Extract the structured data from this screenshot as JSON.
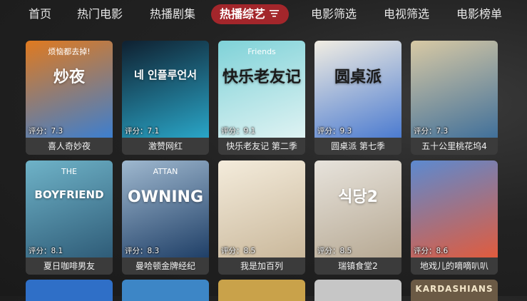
{
  "nav": {
    "tabs": [
      {
        "label": "首页"
      },
      {
        "label": "热门电影"
      },
      {
        "label": "热播剧集"
      },
      {
        "label": "热播综艺",
        "active": true,
        "icon": "filter-icon"
      },
      {
        "label": "电影筛选"
      },
      {
        "label": "电视筛选"
      },
      {
        "label": "电影榜单"
      }
    ]
  },
  "cards": [
    {
      "title": "喜人奇妙夜",
      "rating_label": "评分：",
      "rating": "7.3",
      "poster_text": "炒夜",
      "poster_sub": "烦恼都去掉!",
      "color": "#e07a1f",
      "color2": "#3b7fd1"
    },
    {
      "title": "激赞网红",
      "rating_label": "评分：",
      "rating": "7.1",
      "poster_text": "네 인플루언서",
      "poster_sub": "",
      "color": "#0f2030",
      "color2": "#2aa7c9"
    },
    {
      "title": "快乐老友记 第二季",
      "rating_label": "评分：",
      "rating": "9.1",
      "poster_text": "快乐老友记",
      "poster_sub": "Friends",
      "color": "#7fd2d8",
      "color2": "#e0f3f3"
    },
    {
      "title": "圆桌派 第七季",
      "rating_label": "评分：",
      "rating": "9.3",
      "poster_text": "圆桌派",
      "poster_sub": "",
      "color": "#f1ede2",
      "color2": "#4a7ad0"
    },
    {
      "title": "五十公里桃花坞4",
      "rating_label": "评分：",
      "rating": "7.3",
      "poster_text": "",
      "poster_sub": "",
      "color": "#d8c9a4",
      "color2": "#3f6f9a"
    },
    {
      "title": "夏日咖啡男友",
      "rating_label": "评分：",
      "rating": "8.1",
      "poster_text": "BOYFRIEND",
      "poster_sub": "THE",
      "color": "#6fb3c8",
      "color2": "#2e5b77"
    },
    {
      "title": "曼哈顿金牌经纪",
      "rating_label": "评分：",
      "rating": "8.3",
      "poster_text": "OWNING",
      "poster_sub": "ATTAN",
      "color": "#9fb8cf",
      "color2": "#1e3e66"
    },
    {
      "title": "我是加百列",
      "rating_label": "评分：",
      "rating": "8.5",
      "poster_text": "",
      "poster_sub": "",
      "color": "#f4ecdc",
      "color2": "#c9b79a"
    },
    {
      "title": "瑞镇食堂2",
      "rating_label": "评分：",
      "rating": "8.5",
      "poster_text": "식당2",
      "poster_sub": "",
      "color": "#e7e3dc",
      "color2": "#b6a892"
    },
    {
      "title": "地戏儿的嘀嘀叭叭",
      "rating_label": "评分：",
      "rating": "8.6",
      "poster_text": "",
      "poster_sub": "",
      "color": "#5c8ad0",
      "color2": "#e25b3c"
    }
  ],
  "partial_row": [
    {
      "color": "#2f6fc7"
    },
    {
      "color": "#3d86c6"
    },
    {
      "color": "#c9a24a"
    },
    {
      "color": "#c6c6c6"
    },
    {
      "color": "#6b5a45",
      "text": "KARDASHIANS"
    }
  ]
}
